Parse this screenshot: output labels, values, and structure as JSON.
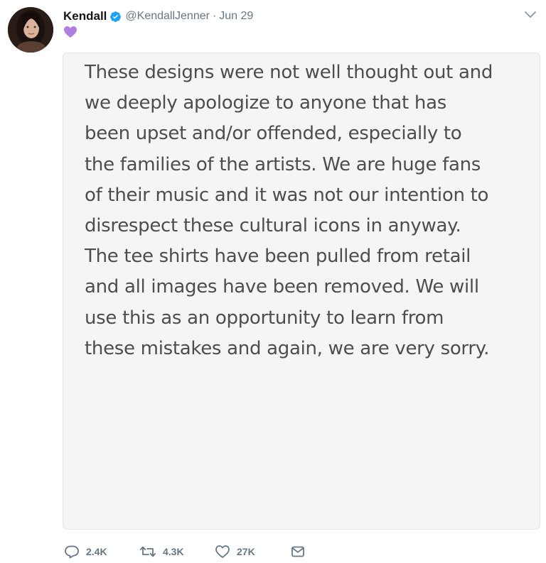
{
  "tweet": {
    "display_name": "Kendall",
    "handle": "@KendallJenner",
    "separator": "·",
    "date": "Jun 29",
    "bio_emoji": "purple-heart",
    "note_lines": [
      "These designs were not well thought out and",
      "we deeply apologize to anyone that has",
      "been upset and/or offended, especially to",
      "the families of the artists. We are huge fans",
      "of their music and it was not our intention to",
      "disrespect these cultural icons in anyway.",
      "The tee shirts have been pulled from retail",
      "and all images have been removed. We will",
      "use this as an opportunity to learn from",
      "these mistakes and again, we are very sorry."
    ]
  },
  "actions": {
    "replies": "2.4K",
    "retweets": "4.3K",
    "likes": "27K"
  },
  "colors": {
    "verified": "#1da1f2",
    "heart": "#b07ee0",
    "muted": "#657786",
    "note_text": "#4d4d4d",
    "note_bg": "#f5f5f5"
  },
  "icons": {
    "reply": "reply-icon",
    "retweet": "retweet-icon",
    "like": "like-icon",
    "message": "direct-message-icon",
    "menu": "chevron-down-icon",
    "verified": "verified-badge-icon"
  }
}
